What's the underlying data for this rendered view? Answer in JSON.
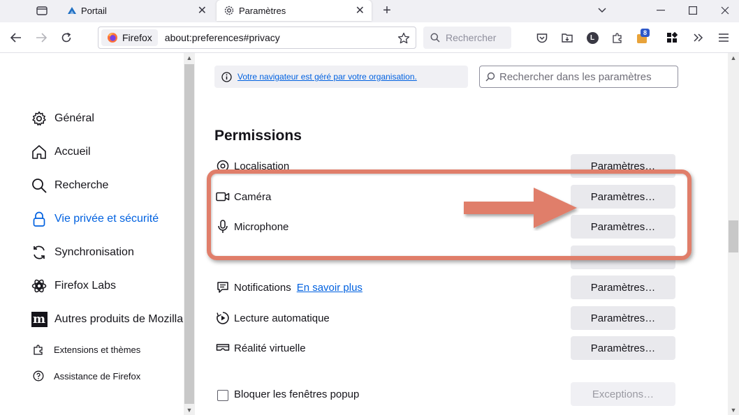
{
  "browser": {
    "tabs": [
      {
        "title": "Portail",
        "active": false
      },
      {
        "title": "Paramètres",
        "active": true
      }
    ],
    "identity_label": "Firefox",
    "url": "about:preferences#privacy",
    "search_placeholder": "Rechercher",
    "extension_badge": "8",
    "profile_initial": "L"
  },
  "sidebar": {
    "categories": [
      {
        "label": "Général",
        "icon": "gear-icon"
      },
      {
        "label": "Accueil",
        "icon": "home-icon"
      },
      {
        "label": "Recherche",
        "icon": "search-icon"
      },
      {
        "label": "Vie privée et sécurité",
        "icon": "lock-icon",
        "selected": true
      },
      {
        "label": "Synchronisation",
        "icon": "sync-icon"
      },
      {
        "label": "Firefox Labs",
        "icon": "labs-icon"
      },
      {
        "label": "Autres produits de Mozilla",
        "icon": "mozilla-icon"
      }
    ],
    "footer": [
      {
        "label": "Extensions et thèmes",
        "icon": "puzzle-icon"
      },
      {
        "label": "Assistance de Firefox",
        "icon": "help-icon"
      }
    ]
  },
  "main": {
    "policy_notice": "Votre navigateur est géré par votre organisation.",
    "search_placeholder": "Rechercher dans les paramètres",
    "section_title": "Permissions",
    "permissions": [
      {
        "label": "Localisation",
        "button": "Paramètres…"
      },
      {
        "label": "Caméra",
        "button": "Paramètres…"
      },
      {
        "label": "Microphone",
        "button": "Paramètres…"
      },
      {
        "label": "Notifications",
        "link": "En savoir plus",
        "button": "Paramètres…"
      },
      {
        "label": "Lecture automatique",
        "button": "Paramètres…"
      },
      {
        "label": "Réalité virtuelle",
        "button": "Paramètres…"
      }
    ],
    "popup_checkbox_label": "Bloquer les fenêtres popup",
    "exceptions_button": "Exceptions…"
  },
  "annotation": {
    "highlight_color": "#e07e6a"
  }
}
